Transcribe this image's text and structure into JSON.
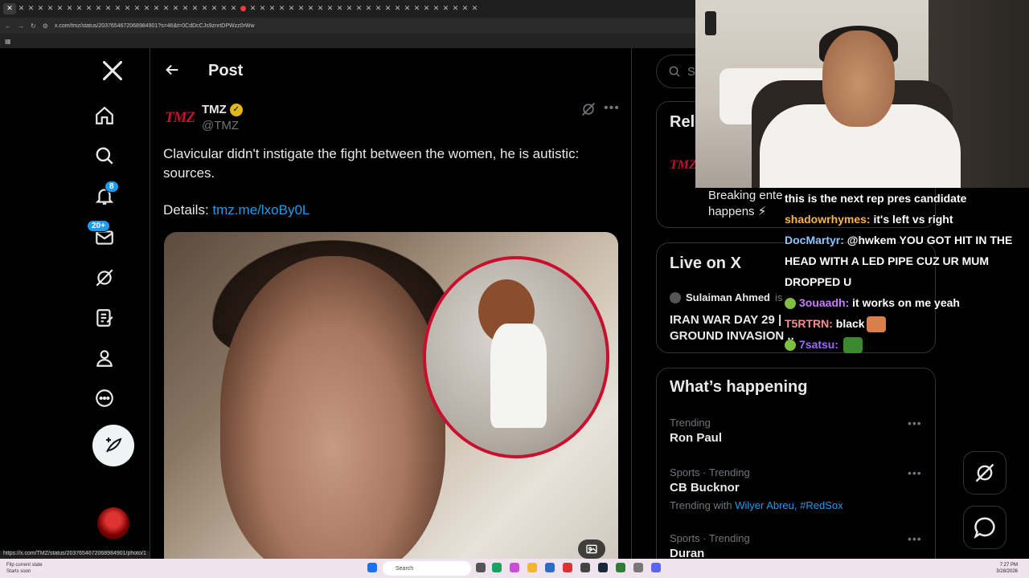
{
  "browser": {
    "url": "x.com/tmz/status/2037654672068984901?s=46&t=0CdDcCJs9znrtDPWzz0rWw",
    "status_url": "https://x.com/TMZ/status/2037654672068984901/photo/1"
  },
  "nav": {
    "notifications_badge": "8",
    "messages_badge": "20+"
  },
  "header": {
    "title": "Post"
  },
  "tweet": {
    "author_name": "TMZ",
    "author_handle": "@TMZ",
    "logo_text": "TMZ",
    "text": "Clavicular didn't instigate the fight between the women, he is autistic: sources.",
    "details_label": "Details:",
    "details_link": "tmz.me/lxoBy0L"
  },
  "right": {
    "search_placeholder": "Se",
    "relevant_title": "Rel",
    "relevant_bio": "Breaking ente",
    "relevant_bio2": "happens ⚡",
    "live_title": "Live on X",
    "live_host": "Sulaiman Ahmed",
    "live_host_suffix": "is",
    "live_stream_title_1": "IRAN WAR DAY 29 |",
    "live_stream_title_2": "GROUND INVASION ..",
    "happening_title": "What’s happening",
    "trends": [
      {
        "category": "Trending",
        "name": "Ron Paul"
      },
      {
        "category": "Sports · Trending",
        "name": "CB Bucknor",
        "with_label": "Trending with",
        "with_links": "Wilyer Abreu, #RedSox"
      },
      {
        "category": "Sports · Trending",
        "name": "Duran"
      }
    ]
  },
  "chat": [
    {
      "user": "",
      "text": "this is the next rep pres candidate"
    },
    {
      "user": "shadowrhymes:",
      "text": "it's left vs right"
    },
    {
      "user": "DocMartyr:",
      "text": "@hwkem YOU GOT HIT IN THE HEAD WITH A LED PIPE CUZ UR MUM DROPPED U"
    },
    {
      "user": "3ouaadh:",
      "text": "it works on me yeah"
    },
    {
      "user": "T5RTRN:",
      "text": "black"
    },
    {
      "user": "7satsu:",
      "text": ""
    }
  ],
  "taskbar": {
    "left_line1": "Flip current state",
    "left_line2": "Starts soon",
    "search": "Search",
    "time": "7:27 PM",
    "date": "3/28/2026"
  },
  "colors": {
    "accent": "#1d9bf0",
    "tmz_red": "#c8102e",
    "verified_gold": "#e2b719"
  }
}
